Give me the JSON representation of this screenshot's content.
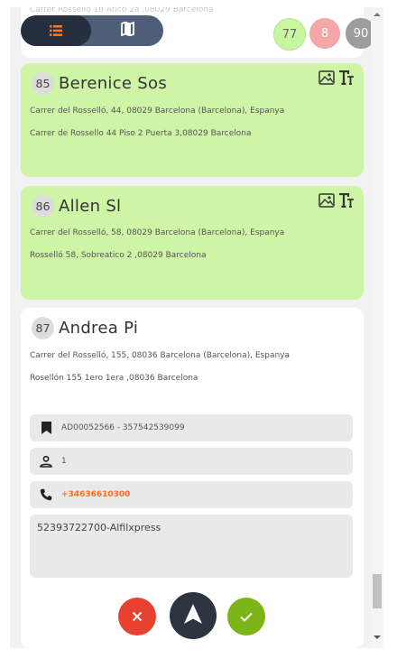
{
  "header": {
    "partial_address": "Carrer Rosselló 18 Àtico 2a ,08029 Barcelona",
    "view_toggle": {
      "list_icon": "list-icon",
      "map_icon": "map-icon",
      "active": "list"
    },
    "badges": [
      {
        "value": "77",
        "color": "#c7f5a0"
      },
      {
        "value": "8",
        "color": "#f5a6a6"
      },
      {
        "value": "90",
        "color": "#9c9c9c"
      }
    ]
  },
  "stops": [
    {
      "number": "85",
      "name": "Berenice Sos",
      "status": "done",
      "address1": "Carrer del Rosselló, 44, 08029 Barcelona (Barcelona), Espanya",
      "address2": "Carrer de Rossello 44 Piso 2 Puerta 3,08029 Barcelona"
    },
    {
      "number": "86",
      "name": "Allen Sl",
      "status": "done",
      "address1": "Carrer del Rosselló, 58, 08029 Barcelona (Barcelona), Espanya",
      "address2": "Rosselló 58, Sobreatico 2 ,08029 Barcelona"
    },
    {
      "number": "87",
      "name": "Andrea Pi",
      "status": "active",
      "address1": "Carrer del Rosselló, 155, 08036 Barcelona (Barcelona), Espanya",
      "address2": "Rosellón 155 1ero 1era ,08036 Barcelona",
      "tracking": "AD00052566 - 357542539099",
      "packages": "1",
      "phone": "+34636610300",
      "notes": "52393722700-Alfilxpress"
    }
  ],
  "colors": {
    "done_card": "#cdf5a5",
    "phone": "#ff6e1f",
    "cancel": "#e8412f",
    "navigate": "#2c3440",
    "confirm": "#7cb518"
  }
}
